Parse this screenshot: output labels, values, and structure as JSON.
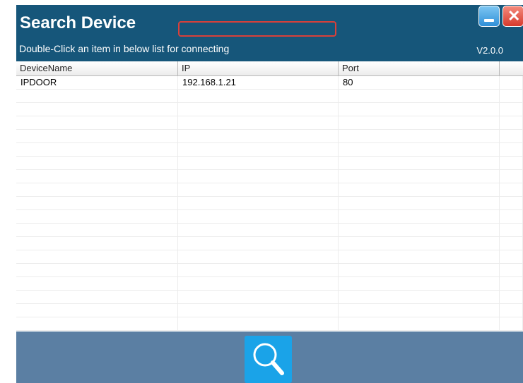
{
  "window": {
    "title": "Search Device",
    "subtitle": "Double-Click an item in below list for connecting",
    "version": "V2.0.0"
  },
  "grid": {
    "columns": [
      {
        "label": "DeviceName"
      },
      {
        "label": "IP"
      },
      {
        "label": "Port"
      },
      {
        "label": ""
      }
    ],
    "rows": [
      {
        "device_name": "IPDOOR",
        "ip": "192.168.1.21",
        "port": "80"
      }
    ]
  },
  "colors": {
    "titlebar": "#16567a",
    "bottombar": "#5b7fa3",
    "search_button": "#1aa3e8",
    "highlight": "#d9403a"
  },
  "icons": {
    "minimize": "minimize-icon",
    "close": "close-icon",
    "search": "search-icon"
  }
}
